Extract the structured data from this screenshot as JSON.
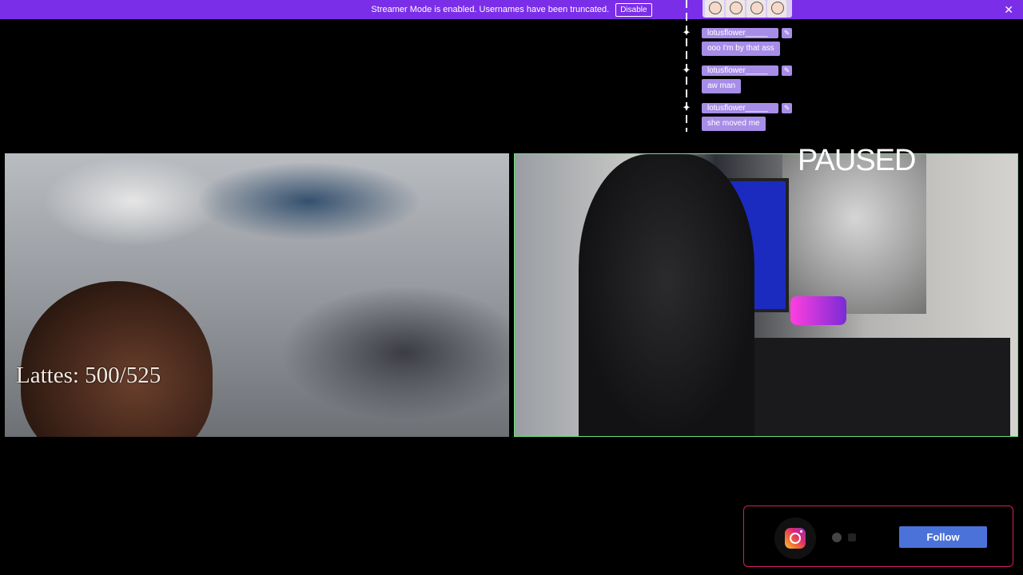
{
  "banner": {
    "message": "Streamer Mode is enabled. Usernames have been truncated.",
    "disable_label": "Disable",
    "close_glyph": "✕"
  },
  "chat": {
    "messages": [
      {
        "username": "lotusflower_____",
        "text": "ooo I'm by that ass"
      },
      {
        "username": "lotusflower_____",
        "text": "aw man"
      },
      {
        "username": "lotusflower_____",
        "text": "she moved me"
      }
    ],
    "edit_glyph": "✎",
    "marker_glyph": "✦"
  },
  "overlay": {
    "lattes": "Lattes: 500/525",
    "paused": "PAUSED"
  },
  "follow_widget": {
    "icon": "instagram-icon",
    "button_label": "Follow"
  },
  "colors": {
    "banner": "#7b2ee8",
    "chat_bubble": "#a78de8",
    "follow_button": "#4a72d9",
    "active_cam_border": "#6de07c",
    "widget_border": "#d41d6a"
  }
}
